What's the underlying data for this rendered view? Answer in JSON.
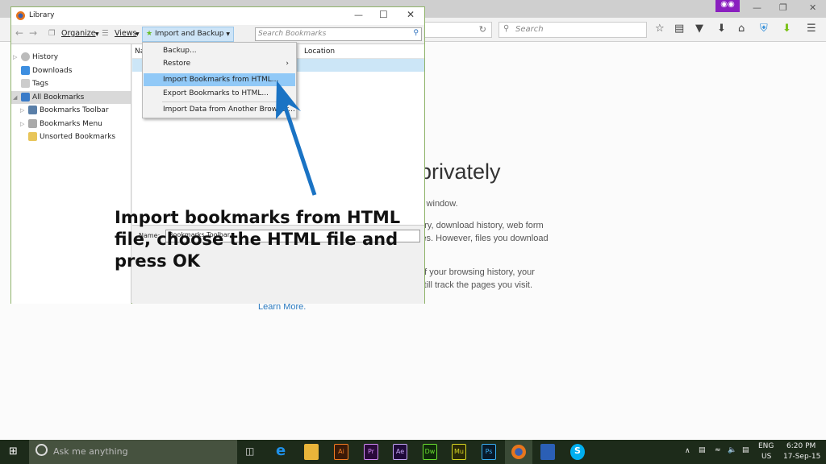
{
  "browser": {
    "search_placeholder": "Search",
    "private_icon": "mask-icon"
  },
  "private_page": {
    "heading": "privately",
    "p1": "s window.",
    "p2a": "ory, download history, web form",
    "p2b": "les. However, files you download",
    "p3a": "of your browsing history, your",
    "p3b": "still track the pages you visit.",
    "learn_more": "Learn More."
  },
  "library": {
    "title": "Library",
    "toolbar": {
      "organize": "Organize",
      "views": "Views",
      "import_backup": "Import and Backup",
      "search_placeholder": "Search Bookmarks"
    },
    "tree": [
      {
        "label": "History"
      },
      {
        "label": "Downloads"
      },
      {
        "label": "Tags"
      },
      {
        "label": "All Bookmarks"
      },
      {
        "label": "Bookmarks Toolbar"
      },
      {
        "label": "Bookmarks Menu"
      },
      {
        "label": "Unsorted Bookmarks"
      }
    ],
    "columns": {
      "name": "Na",
      "location": "Location"
    },
    "details": {
      "name_label": "Name:",
      "name_value": "Bookmarks Toolbar"
    }
  },
  "menu": {
    "items": [
      {
        "label": "Backup..."
      },
      {
        "label": "Restore"
      },
      {
        "label": "Import Bookmarks from HTML..."
      },
      {
        "label": "Export Bookmarks to HTML..."
      },
      {
        "label": "Import Data from Another Browser..."
      }
    ]
  },
  "annotation": {
    "text": "Import bookmarks from HTML\nfile, choose the HTML file and\npress OK",
    "arrow_color": "#1a73c4"
  },
  "taskbar": {
    "search_placeholder": "Ask me anything",
    "apps": [
      "Ai",
      "Pr",
      "Ae",
      "Dw",
      "Mu",
      "Ps"
    ],
    "lang": "ENG",
    "region": "US",
    "time": "6:20 PM",
    "date": "17-Sep-15"
  }
}
